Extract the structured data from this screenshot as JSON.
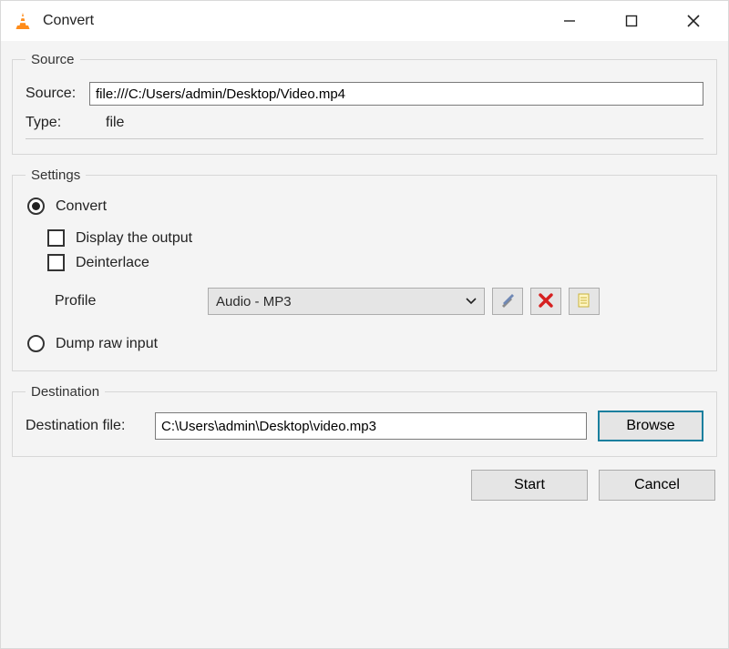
{
  "window": {
    "title": "Convert"
  },
  "source_group": {
    "legend": "Source",
    "source_label": "Source:",
    "source_value": "file:///C:/Users/admin/Desktop/Video.mp4",
    "type_label": "Type:",
    "type_value": "file"
  },
  "settings_group": {
    "legend": "Settings",
    "convert_label": "Convert",
    "convert_checked": true,
    "display_output_label": "Display the output",
    "display_output_checked": false,
    "deinterlace_label": "Deinterlace",
    "deinterlace_checked": false,
    "profile_label": "Profile",
    "profile_value": "Audio - MP3",
    "dump_raw_label": "Dump raw input",
    "dump_raw_checked": false
  },
  "destination_group": {
    "legend": "Destination",
    "dest_label": "Destination file:",
    "dest_value": "C:\\Users\\admin\\Desktop\\video.mp3",
    "browse_label": "Browse"
  },
  "footer": {
    "start_label": "Start",
    "cancel_label": "Cancel"
  },
  "icons": {
    "edit_profile": "edit-profile",
    "delete_profile": "delete-profile",
    "new_profile": "new-profile"
  }
}
